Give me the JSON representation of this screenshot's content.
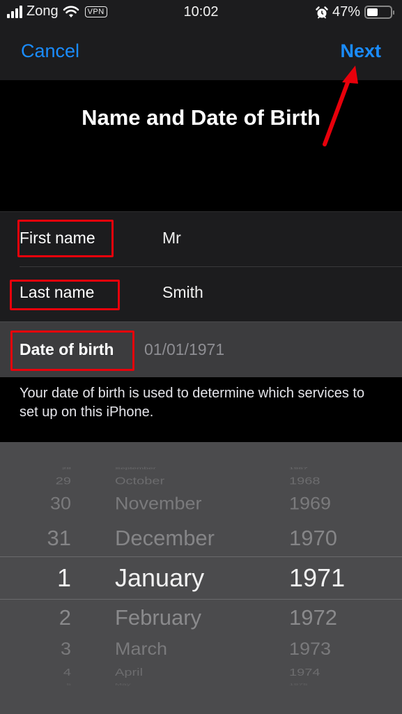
{
  "status_bar": {
    "carrier": "Zong",
    "vpn_label": "VPN",
    "time": "10:02",
    "battery_percent": "47%",
    "battery_level": 0.47,
    "icons": [
      "signal-icon",
      "wifi-icon",
      "vpn-icon",
      "alarm-icon",
      "battery-icon"
    ]
  },
  "nav": {
    "cancel_label": "Cancel",
    "next_label": "Next",
    "accent_color": "#1a8cff"
  },
  "page_title": "Name and Date of Birth",
  "form": {
    "first_name": {
      "label": "First name",
      "value": "Mr"
    },
    "last_name": {
      "label": "Last name",
      "value": "Smith"
    },
    "date_of_birth": {
      "label": "Date of birth",
      "value": "01/01/1971"
    }
  },
  "footer_note": "Your date of birth is used to determine which services to set up on this iPhone.",
  "picker": {
    "days": [
      "28",
      "29",
      "30",
      "31",
      "1",
      "2",
      "3",
      "4",
      "5"
    ],
    "months": [
      "September",
      "October",
      "November",
      "December",
      "January",
      "February",
      "March",
      "April",
      "May"
    ],
    "years": [
      "1967",
      "1968",
      "1969",
      "1970",
      "1971",
      "1972",
      "1973",
      "1974",
      "1975"
    ],
    "selected_index": 4,
    "selected": {
      "day": "1",
      "month": "January",
      "year": "1971"
    }
  },
  "annotations": {
    "highlight_color": "#e8000b",
    "highlighted_fields": [
      "First name",
      "Last name",
      "Date of birth"
    ],
    "arrow_target": "Next"
  }
}
